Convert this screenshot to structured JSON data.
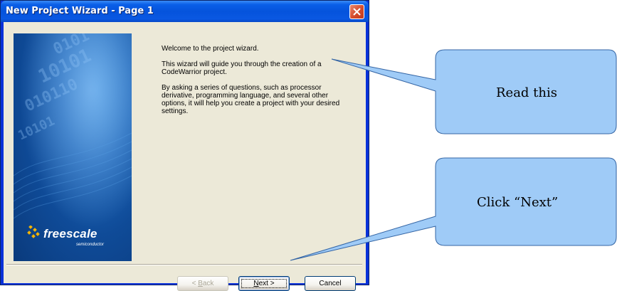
{
  "window": {
    "title": "New Project Wizard - Page  1"
  },
  "content": {
    "welcome": "Welcome to the project wizard.",
    "guide": "This wizard will guide you through the creation of a CodeWarrior project.",
    "asking": "By asking a series of questions, such as processor derivative, programming language, and several other options, it will help you create a project with your desired settings."
  },
  "banner": {
    "logo_text": "freescale",
    "logo_subtext": "semiconductor"
  },
  "buttons": {
    "back_prefix": "< ",
    "back_key": "B",
    "back_rest": "ack",
    "next_key": "N",
    "next_rest": "ext >",
    "cancel": "Cancel"
  },
  "callouts": {
    "read": "Read this",
    "next": "Click “Next”",
    "fill_color": "#9fcbf7",
    "stroke_color": "#3465a4"
  }
}
